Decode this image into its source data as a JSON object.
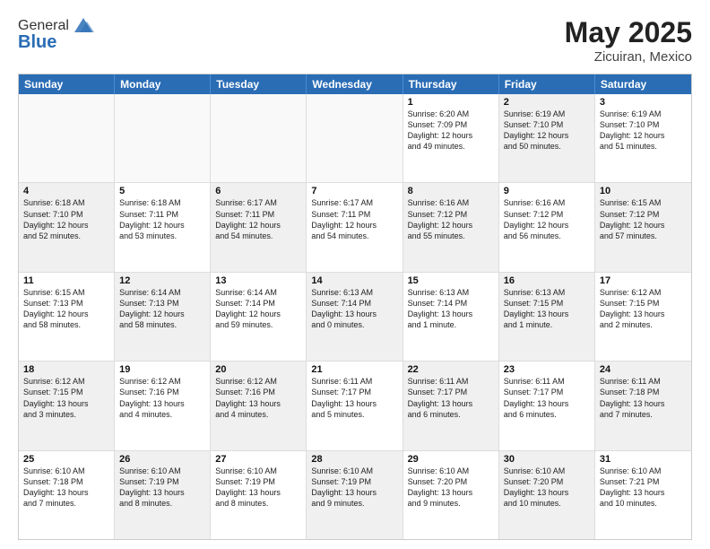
{
  "header": {
    "logo_general": "General",
    "logo_blue": "Blue",
    "title": "May 2025",
    "location": "Zicuiran, Mexico"
  },
  "days_of_week": [
    "Sunday",
    "Monday",
    "Tuesday",
    "Wednesday",
    "Thursday",
    "Friday",
    "Saturday"
  ],
  "weeks": [
    [
      {
        "day": "",
        "info": "",
        "shaded": false,
        "empty": true
      },
      {
        "day": "",
        "info": "",
        "shaded": false,
        "empty": true
      },
      {
        "day": "",
        "info": "",
        "shaded": false,
        "empty": true
      },
      {
        "day": "",
        "info": "",
        "shaded": false,
        "empty": true
      },
      {
        "day": "1",
        "info": "Sunrise: 6:20 AM\nSunset: 7:09 PM\nDaylight: 12 hours\nand 49 minutes.",
        "shaded": false,
        "empty": false
      },
      {
        "day": "2",
        "info": "Sunrise: 6:19 AM\nSunset: 7:10 PM\nDaylight: 12 hours\nand 50 minutes.",
        "shaded": true,
        "empty": false
      },
      {
        "day": "3",
        "info": "Sunrise: 6:19 AM\nSunset: 7:10 PM\nDaylight: 12 hours\nand 51 minutes.",
        "shaded": false,
        "empty": false
      }
    ],
    [
      {
        "day": "4",
        "info": "Sunrise: 6:18 AM\nSunset: 7:10 PM\nDaylight: 12 hours\nand 52 minutes.",
        "shaded": true,
        "empty": false
      },
      {
        "day": "5",
        "info": "Sunrise: 6:18 AM\nSunset: 7:11 PM\nDaylight: 12 hours\nand 53 minutes.",
        "shaded": false,
        "empty": false
      },
      {
        "day": "6",
        "info": "Sunrise: 6:17 AM\nSunset: 7:11 PM\nDaylight: 12 hours\nand 54 minutes.",
        "shaded": true,
        "empty": false
      },
      {
        "day": "7",
        "info": "Sunrise: 6:17 AM\nSunset: 7:11 PM\nDaylight: 12 hours\nand 54 minutes.",
        "shaded": false,
        "empty": false
      },
      {
        "day": "8",
        "info": "Sunrise: 6:16 AM\nSunset: 7:12 PM\nDaylight: 12 hours\nand 55 minutes.",
        "shaded": true,
        "empty": false
      },
      {
        "day": "9",
        "info": "Sunrise: 6:16 AM\nSunset: 7:12 PM\nDaylight: 12 hours\nand 56 minutes.",
        "shaded": false,
        "empty": false
      },
      {
        "day": "10",
        "info": "Sunrise: 6:15 AM\nSunset: 7:12 PM\nDaylight: 12 hours\nand 57 minutes.",
        "shaded": true,
        "empty": false
      }
    ],
    [
      {
        "day": "11",
        "info": "Sunrise: 6:15 AM\nSunset: 7:13 PM\nDaylight: 12 hours\nand 58 minutes.",
        "shaded": false,
        "empty": false
      },
      {
        "day": "12",
        "info": "Sunrise: 6:14 AM\nSunset: 7:13 PM\nDaylight: 12 hours\nand 58 minutes.",
        "shaded": true,
        "empty": false
      },
      {
        "day": "13",
        "info": "Sunrise: 6:14 AM\nSunset: 7:14 PM\nDaylight: 12 hours\nand 59 minutes.",
        "shaded": false,
        "empty": false
      },
      {
        "day": "14",
        "info": "Sunrise: 6:13 AM\nSunset: 7:14 PM\nDaylight: 13 hours\nand 0 minutes.",
        "shaded": true,
        "empty": false
      },
      {
        "day": "15",
        "info": "Sunrise: 6:13 AM\nSunset: 7:14 PM\nDaylight: 13 hours\nand 1 minute.",
        "shaded": false,
        "empty": false
      },
      {
        "day": "16",
        "info": "Sunrise: 6:13 AM\nSunset: 7:15 PM\nDaylight: 13 hours\nand 1 minute.",
        "shaded": true,
        "empty": false
      },
      {
        "day": "17",
        "info": "Sunrise: 6:12 AM\nSunset: 7:15 PM\nDaylight: 13 hours\nand 2 minutes.",
        "shaded": false,
        "empty": false
      }
    ],
    [
      {
        "day": "18",
        "info": "Sunrise: 6:12 AM\nSunset: 7:15 PM\nDaylight: 13 hours\nand 3 minutes.",
        "shaded": true,
        "empty": false
      },
      {
        "day": "19",
        "info": "Sunrise: 6:12 AM\nSunset: 7:16 PM\nDaylight: 13 hours\nand 4 minutes.",
        "shaded": false,
        "empty": false
      },
      {
        "day": "20",
        "info": "Sunrise: 6:12 AM\nSunset: 7:16 PM\nDaylight: 13 hours\nand 4 minutes.",
        "shaded": true,
        "empty": false
      },
      {
        "day": "21",
        "info": "Sunrise: 6:11 AM\nSunset: 7:17 PM\nDaylight: 13 hours\nand 5 minutes.",
        "shaded": false,
        "empty": false
      },
      {
        "day": "22",
        "info": "Sunrise: 6:11 AM\nSunset: 7:17 PM\nDaylight: 13 hours\nand 6 minutes.",
        "shaded": true,
        "empty": false
      },
      {
        "day": "23",
        "info": "Sunrise: 6:11 AM\nSunset: 7:17 PM\nDaylight: 13 hours\nand 6 minutes.",
        "shaded": false,
        "empty": false
      },
      {
        "day": "24",
        "info": "Sunrise: 6:11 AM\nSunset: 7:18 PM\nDaylight: 13 hours\nand 7 minutes.",
        "shaded": true,
        "empty": false
      }
    ],
    [
      {
        "day": "25",
        "info": "Sunrise: 6:10 AM\nSunset: 7:18 PM\nDaylight: 13 hours\nand 7 minutes.",
        "shaded": false,
        "empty": false
      },
      {
        "day": "26",
        "info": "Sunrise: 6:10 AM\nSunset: 7:19 PM\nDaylight: 13 hours\nand 8 minutes.",
        "shaded": true,
        "empty": false
      },
      {
        "day": "27",
        "info": "Sunrise: 6:10 AM\nSunset: 7:19 PM\nDaylight: 13 hours\nand 8 minutes.",
        "shaded": false,
        "empty": false
      },
      {
        "day": "28",
        "info": "Sunrise: 6:10 AM\nSunset: 7:19 PM\nDaylight: 13 hours\nand 9 minutes.",
        "shaded": true,
        "empty": false
      },
      {
        "day": "29",
        "info": "Sunrise: 6:10 AM\nSunset: 7:20 PM\nDaylight: 13 hours\nand 9 minutes.",
        "shaded": false,
        "empty": false
      },
      {
        "day": "30",
        "info": "Sunrise: 6:10 AM\nSunset: 7:20 PM\nDaylight: 13 hours\nand 10 minutes.",
        "shaded": true,
        "empty": false
      },
      {
        "day": "31",
        "info": "Sunrise: 6:10 AM\nSunset: 7:21 PM\nDaylight: 13 hours\nand 10 minutes.",
        "shaded": false,
        "empty": false
      }
    ]
  ]
}
